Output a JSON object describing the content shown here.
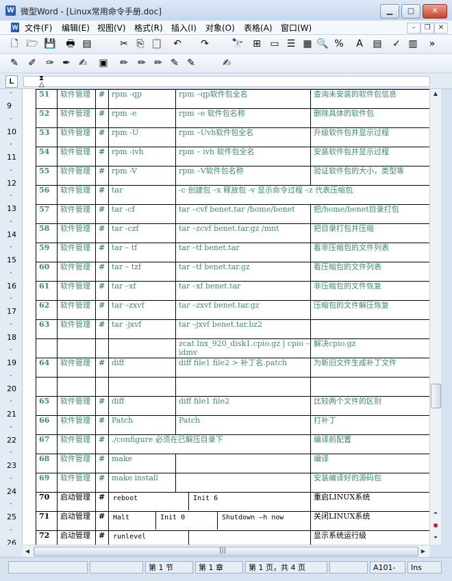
{
  "window": {
    "app_badge": "W",
    "title": "微型Word - [Linux常用命令手册.doc]"
  },
  "menu": {
    "doc_badge": "W",
    "items": [
      "文件(F)",
      "编辑(E)",
      "视图(V)",
      "格式(R)",
      "插入(I)",
      "对象(O)",
      "表格(A)",
      "窗口(W)"
    ]
  },
  "toolbar1_icons": [
    "new-icon",
    "open-icon",
    "save-icon",
    "print-icon",
    "pdf-icon",
    "cut-icon",
    "copy-icon",
    "paste-icon",
    "undo-icon",
    "redo-icon",
    "find-icon",
    "table-view-icon",
    "page-view-icon",
    "outline-icon",
    "layout-icon",
    "zoom-icon",
    "spellcheck-icon",
    "font-color-icon",
    "insert-table-icon",
    "abc-icon",
    "chart-icon",
    "more-icon"
  ],
  "toolbar2_icons": [
    "mark-icon",
    "edit-mark-icon",
    "delete-mark-icon",
    "copy-mark-icon",
    "paste-mark-icon",
    "active-mark-icon",
    "pen-icon",
    "pen2-icon",
    "pen3-icon",
    "pen4-icon",
    "pen5-icon",
    "review-icon"
  ],
  "vruler_numbers": [
    "9",
    "10",
    "11",
    "12",
    "13",
    "14",
    "15",
    "16",
    "17",
    "18",
    "19",
    "20",
    "21",
    "22",
    "23",
    "24",
    "25",
    "26"
  ],
  "table": {
    "rows": [
      {
        "num": "51",
        "cat": "软件管理",
        "hash": "#",
        "cmd": "rpm -qp",
        "ex": "rpm –qp软件包全名",
        "desc": "查询未安装的软件包信息"
      },
      {
        "num": "52",
        "cat": "软件管理",
        "hash": "#",
        "cmd": "rpm -e",
        "ex": "rpm –e 软件包名称",
        "desc": "删除具体的软件包"
      },
      {
        "num": "53",
        "cat": "软件管理",
        "hash": "#",
        "cmd": "rpm -U",
        "ex": "rpm –Uvh软件包全名",
        "desc": "升级软件包并显示过程"
      },
      {
        "num": "54",
        "cat": "软件管理",
        "hash": "#",
        "cmd": "rpm -ivh",
        "ex": "rpm – ivh 软件包全名",
        "desc": "安装软件包并显示过程"
      },
      {
        "num": "55",
        "cat": "软件管理",
        "hash": "#",
        "cmd": "rpm -V",
        "ex": "rpm –V软件包名称",
        "desc": "验证软件包的大小，类型等"
      },
      {
        "num": "56",
        "cat": "软件管理",
        "hash": "#",
        "cmd": "tar",
        "ex": "-c 创建包 –x 释放包  -v 显示命令过程 –z 代表压缩包",
        "desc": ""
      },
      {
        "num": "57",
        "cat": "软件管理",
        "hash": "#",
        "cmd": "tar -cf",
        "ex": "tar –cvf benet.tar /home/benet",
        "desc": "把/home/benet目录打包"
      },
      {
        "num": "58",
        "cat": "软件管理",
        "hash": "#",
        "cmd": "tar -czf",
        "ex": "tar –zcvf benet.tar.gz /mnt",
        "desc": "把目录打包并压缩"
      },
      {
        "num": "59",
        "cat": "软件管理",
        "hash": "#",
        "cmd": "tar – tf",
        "ex": "tar –tf benet.tar",
        "desc": "看非压缩包的文件列表"
      },
      {
        "num": "60",
        "cat": "软件管理",
        "hash": "#",
        "cmd": "tar – tzf",
        "ex": "tar –tf benet.tar.gz",
        "desc": "看压缩包的文件列表"
      },
      {
        "num": "61",
        "cat": "软件管理",
        "hash": "#",
        "cmd": "tar –xf",
        "ex": "tar –xf benet.tar",
        "desc": "非压缩包的文件恢复"
      },
      {
        "num": "62",
        "cat": "软件管理",
        "hash": "#",
        "cmd": "tar –zxvf",
        "ex": "tar –zxvf benet.tar.gz",
        "desc": "压缩包的文件解压恢复"
      },
      {
        "num": "63",
        "cat": "软件管理",
        "hash": "#",
        "cmd": "tar -jxvf",
        "ex": "tar –jxvf benet.tar.bz2",
        "desc": ""
      },
      {
        "num": "",
        "cat": "",
        "hash": "",
        "cmd": "",
        "ex": "zcat lnx_920_disk1.cpio.gz | cpio –idmv",
        "desc": "解决cpio.gz"
      },
      {
        "num": "64",
        "cat": "软件管理",
        "hash": "#",
        "cmd": "diff",
        "ex": "diff file1 file2 > 补丁名.patch",
        "desc": "为新旧文件生成补丁文件"
      },
      {
        "num": "",
        "cat": "",
        "hash": "",
        "cmd": "",
        "ex": "",
        "desc": ""
      },
      {
        "num": "65",
        "cat": "软件管理",
        "hash": "#",
        "cmd": "diff",
        "ex": "diff file1 file2",
        "desc": "比较两个文件的区别"
      },
      {
        "num": "66",
        "cat": "软件管理",
        "hash": "#",
        "cmd": "Patch",
        "ex": "Patch",
        "desc": "打补丁"
      },
      {
        "num": "67",
        "cat": "软件管理",
        "hash": "#",
        "cmd": "./configure 必须在已解压目录下",
        "ex": "",
        "desc": "编译前配置"
      },
      {
        "num": "68",
        "cat": "软件管理",
        "hash": "#",
        "cmd": "make",
        "ex": "",
        "desc": "编译"
      },
      {
        "num": "69",
        "cat": "软件管理",
        "hash": "#",
        "cmd": "make install",
        "ex": "",
        "desc": "安装编译好的源码包"
      }
    ],
    "r70": {
      "num": "70",
      "cat": "启动管理",
      "hash": "#",
      "c1": "reboot",
      "c2": "Init 6",
      "desc": "重启LINUX系统"
    },
    "r71": {
      "num": "71",
      "cat": "启动管理",
      "hash": "#",
      "c1": "Halt",
      "c2": "Init 0",
      "c3": "Shutdown –h now",
      "desc": "关闭LINUX系统"
    },
    "r72": {
      "num": "72",
      "cat": "启动管理",
      "hash": "#",
      "c1": "runlevel",
      "desc": "显示系统运行级"
    }
  },
  "status": {
    "section": "第 1 节",
    "chapter": "第 1 章",
    "page": "第 1 页，共 4 页",
    "position": "A101-",
    "mode": "Ins"
  },
  "colors": {
    "table_text": "#3c8a70",
    "chrome": "#d6e2ef"
  }
}
